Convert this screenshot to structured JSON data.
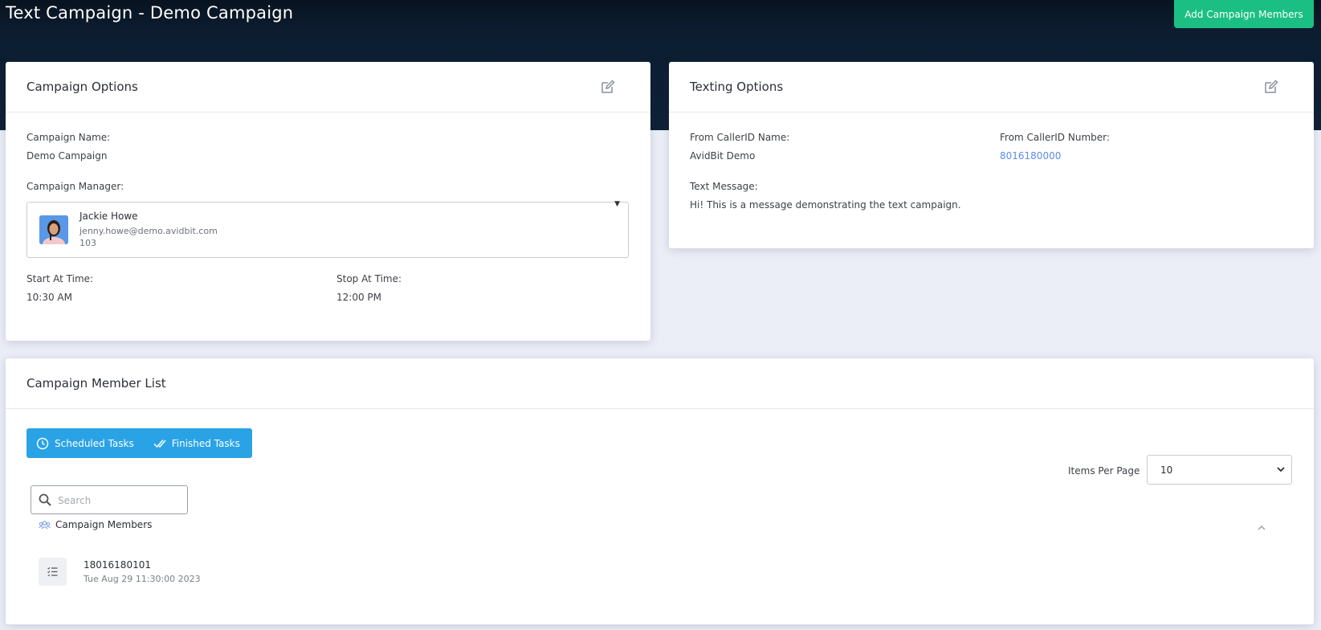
{
  "header": {
    "title": "Text Campaign - Demo Campaign",
    "add_members_label": "Add Campaign Members"
  },
  "campaign_options": {
    "title": "Campaign Options",
    "name_label": "Campaign Name:",
    "name_value": "Demo Campaign",
    "manager_label": "Campaign Manager:",
    "manager": {
      "name": "Jackie Howe",
      "email": "jenny.howe@demo.avidbit.com",
      "extension": "103"
    },
    "start_label": "Start At Time:",
    "start_value": "10:30 AM",
    "stop_label": "Stop At Time:",
    "stop_value": "12:00 PM"
  },
  "texting_options": {
    "title": "Texting Options",
    "caller_name_label": "From CallerID Name:",
    "caller_name_value": "AvidBit Demo",
    "caller_number_label": "From CallerID Number:",
    "caller_number_value": "8016180000",
    "message_label": "Text Message:",
    "message_value": "Hi! This is a message demonstrating the text campaign."
  },
  "member_list": {
    "title": "Campaign Member List",
    "tabs": [
      {
        "label": "Scheduled Tasks",
        "icon": "clock-icon"
      },
      {
        "label": "Finished Tasks",
        "icon": "double-check-icon"
      }
    ],
    "items_per_page_label": "Items Per Page",
    "items_per_page_value": "10",
    "search_placeholder": "Search",
    "members_header": "Campaign Members",
    "members": [
      {
        "number": "18016180101",
        "date": "Tue Aug 29 11:30:00 2023"
      }
    ]
  },
  "colors": {
    "header_bg": "#0c1d30",
    "accent_green": "#1bbf83",
    "accent_blue": "#2aa3e6",
    "link_blue": "#5a8de8",
    "page_bg": "#eceef7"
  }
}
